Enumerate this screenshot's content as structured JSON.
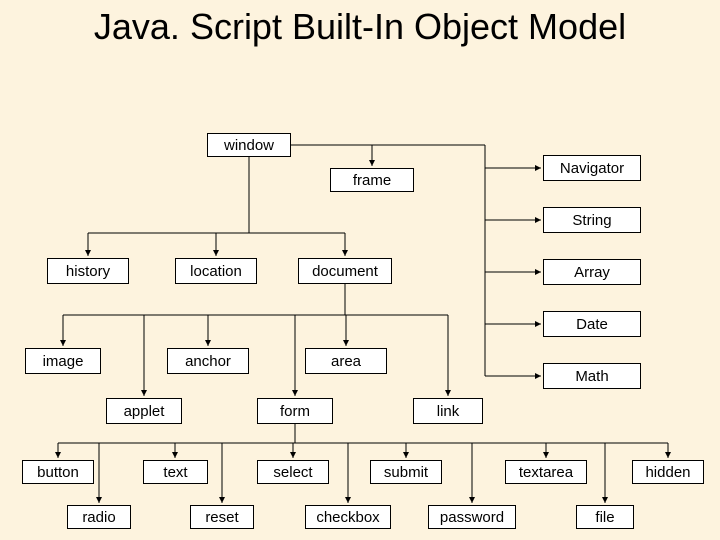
{
  "title": "Java. Script Built-In Object Model",
  "nodes": {
    "window": "window",
    "frame": "frame",
    "navigator": "Navigator",
    "string": "String",
    "array": "Array",
    "date": "Date",
    "math": "Math",
    "history": "history",
    "location": "location",
    "document": "document",
    "image": "image",
    "anchor": "anchor",
    "area": "area",
    "applet": "applet",
    "form": "form",
    "link": "link",
    "button": "button",
    "text": "text",
    "select": "select",
    "submit": "submit",
    "textarea": "textarea",
    "hidden": "hidden",
    "radio": "radio",
    "reset": "reset",
    "checkbox": "checkbox",
    "password": "password",
    "file": "file"
  }
}
